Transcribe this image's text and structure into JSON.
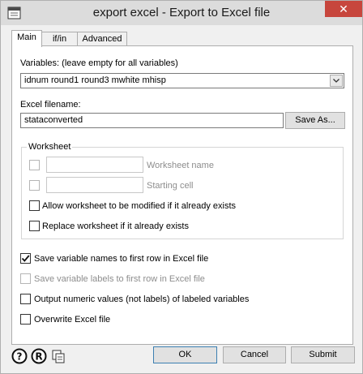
{
  "window": {
    "title": "export excel - Export to Excel file",
    "close_glyph": "✕"
  },
  "tabs": [
    {
      "label": "Main",
      "active": true
    },
    {
      "label": "if/in",
      "active": false
    },
    {
      "label": "Advanced",
      "active": false
    }
  ],
  "variables": {
    "label": "Variables:  (leave empty for all variables)",
    "value": "idnum round1 round3 mwhite mhisp"
  },
  "excel": {
    "label": "Excel filename:",
    "value": "stataconverted",
    "save_as": "Save As..."
  },
  "worksheet": {
    "title": "Worksheet",
    "name_label": "Worksheet name",
    "cell_label": "Starting cell",
    "modify_label": "Allow worksheet to be modified if it already exists",
    "replace_label": "Replace worksheet if it already exists"
  },
  "options": {
    "save_names": {
      "label": "Save variable names to first row in Excel file",
      "checked": true
    },
    "save_labels": {
      "label": "Save variable labels to first row in Excel file",
      "checked": false,
      "disabled": true
    },
    "numeric": {
      "label": "Output numeric values (not labels) of labeled variables",
      "checked": false
    },
    "overwrite": {
      "label": "Overwrite Excel file",
      "checked": false
    }
  },
  "buttons": {
    "ok": "OK",
    "cancel": "Cancel",
    "submit": "Submit"
  },
  "icons": [
    "help-icon",
    "reset-icon",
    "copy-command-icon"
  ]
}
